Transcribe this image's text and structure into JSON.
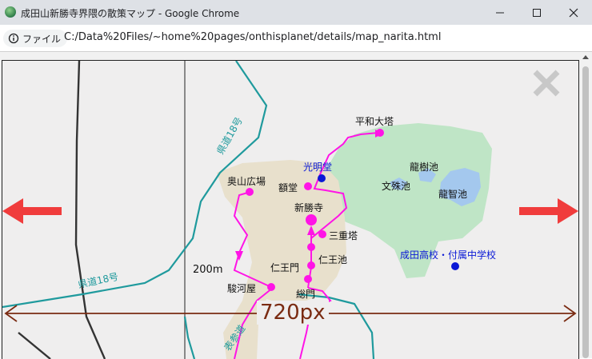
{
  "window": {
    "title": "成田山新勝寺界隈の散策マップ - Google Chrome",
    "controls": [
      "minimize",
      "maximize",
      "close"
    ]
  },
  "addressbar": {
    "chip_label": "ファイル",
    "url": "C:/Data%20Files/~home%20pages/onthisplanet/details/map_narita.html"
  },
  "map": {
    "labels": {
      "heiwa_taito": "平和大塔",
      "komyodo": "光明堂",
      "okuyama_hiroba": "奥山広場",
      "gakudo": "額堂",
      "ryujuike": "龍樹池",
      "bunshuike": "文殊池",
      "ryuchiike": "龍智池",
      "shinshoji": "新勝寺",
      "sanjunoto": "三重塔",
      "nioike": "仁王池",
      "niomon": "仁王門",
      "soumon": "総門",
      "surugaya": "駿河屋",
      "narita_school": "成田高校・付属中学校",
      "scale_200m": "200m",
      "road_18_a": "県道18号",
      "road_18_b": "県道18号",
      "omotesando": "表参道"
    },
    "measure_label": "720px",
    "colors": {
      "route": "#ff14e6",
      "arrow": "#f03c3c",
      "measure": "#7a2b12",
      "park": "#bfe5c6",
      "temple_area": "#e8e0cc",
      "pond": "#a4c8ee",
      "road": "#1f9a9d"
    }
  }
}
